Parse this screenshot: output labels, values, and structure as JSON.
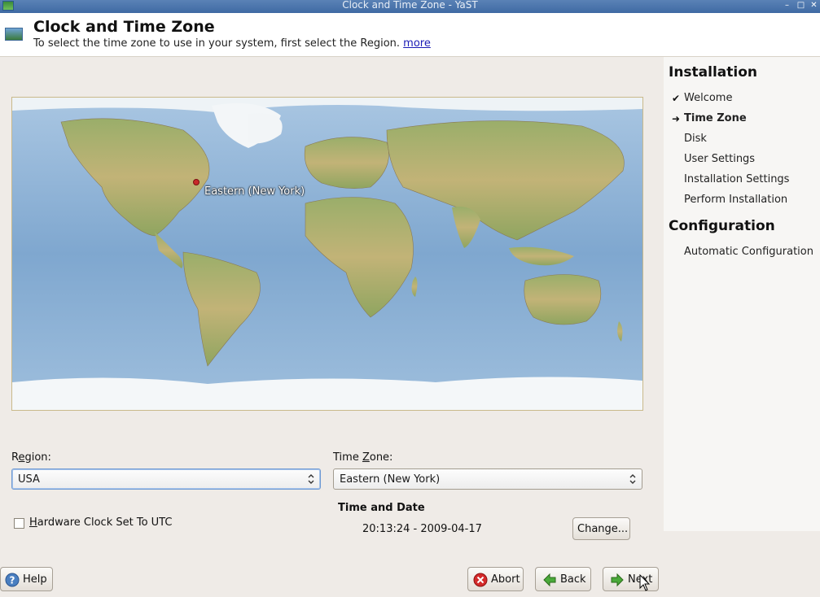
{
  "window": {
    "title": "Clock and Time Zone - YaST"
  },
  "header": {
    "title": "Clock and Time Zone",
    "subtitle": "To select the time zone to use in your system, first select the Region.",
    "more_link": "more"
  },
  "map": {
    "selected_label": "Eastern (New York)"
  },
  "region": {
    "label_pre": "R",
    "label_accel": "e",
    "label_post": "gion:",
    "value": "USA"
  },
  "timezone": {
    "label_pre": "Time ",
    "label_accel": "Z",
    "label_post": "one:",
    "value": "Eastern (New York)"
  },
  "hwclock": {
    "label_accel": "H",
    "label_post": "ardware Clock Set To UTC",
    "checked": false
  },
  "time_date": {
    "heading": "Time and Date",
    "value": "20:13:24 - 2009-04-17",
    "change_label": "Change..."
  },
  "buttons": {
    "help": "Help",
    "abort": "Abort",
    "back": "Back",
    "next": "Next"
  },
  "sidebar": {
    "installation_heading": "Installation",
    "steps": [
      {
        "label": "Welcome",
        "mark": "✔"
      },
      {
        "label": "Time Zone",
        "mark": "➜"
      },
      {
        "label": "Disk",
        "mark": ""
      },
      {
        "label": "User Settings",
        "mark": ""
      },
      {
        "label": "Installation Settings",
        "mark": ""
      },
      {
        "label": "Perform Installation",
        "mark": ""
      }
    ],
    "configuration_heading": "Configuration",
    "config_steps": [
      {
        "label": "Automatic Configuration"
      }
    ]
  },
  "colors": {
    "accent": "#3f6aa3",
    "ocean": "#8fb4d6",
    "land": "#a8b86a",
    "marker": "#c8282a"
  }
}
